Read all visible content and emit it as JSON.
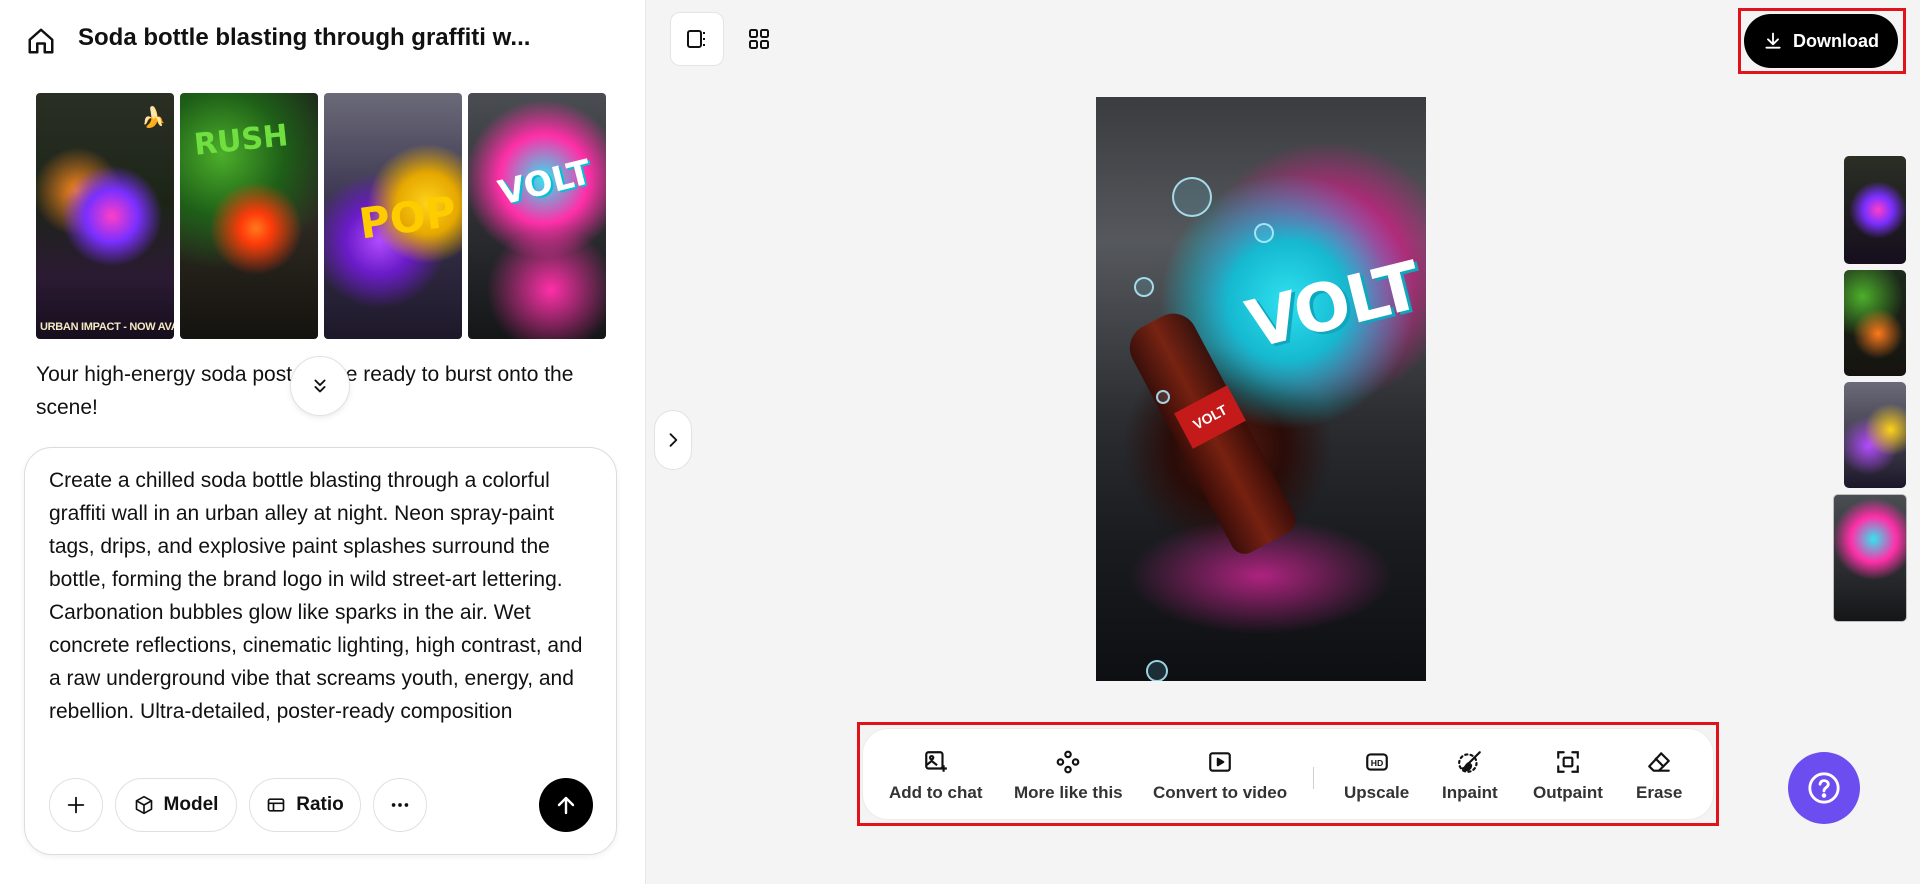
{
  "header": {
    "title": "Soda bottle blasting through graffiti w..."
  },
  "thumbnails": {
    "first_caption": "URBAN IMPACT - NOW AVAILABLE",
    "first_badge": "🍌",
    "graffiti_words": [
      "RUSH",
      "POP",
      "VOLT"
    ]
  },
  "chat": {
    "reply": "Your high-energy soda posters are ready to burst onto the scene!"
  },
  "composer": {
    "prompt": "Create a chilled soda bottle blasting through a colorful graffiti wall in an urban alley at night. Neon spray-paint tags, drips, and explosive paint splashes surround the bottle, forming the brand logo in wild street-art lettering. Carbonation bubbles glow like sparks in the air. Wet concrete reflections, cinematic lighting, high contrast, and a raw underground vibe that screams youth, energy, and rebellion. Ultra-detailed, poster-ready composition",
    "model_label": "Model",
    "ratio_label": "Ratio"
  },
  "toolbar": {
    "download_label": "Download"
  },
  "preview": {
    "logo_text": "VOLT",
    "bottle_label": "VOLT"
  },
  "actions": [
    {
      "label": "Add to chat",
      "icon": "image-plus-icon"
    },
    {
      "label": "More like this",
      "icon": "nodes-icon"
    },
    {
      "label": "Convert to video",
      "icon": "play-square-icon"
    },
    {
      "label": "Upscale",
      "icon": "hd-icon"
    },
    {
      "label": "Inpaint",
      "icon": "brush-icon"
    },
    {
      "label": "Outpaint",
      "icon": "expand-frame-icon"
    },
    {
      "label": "Erase",
      "icon": "eraser-icon"
    }
  ],
  "colors": {
    "accent_help": "#6c4ef0",
    "highlight_red": "#e0121a",
    "primary_button": "#000000"
  }
}
